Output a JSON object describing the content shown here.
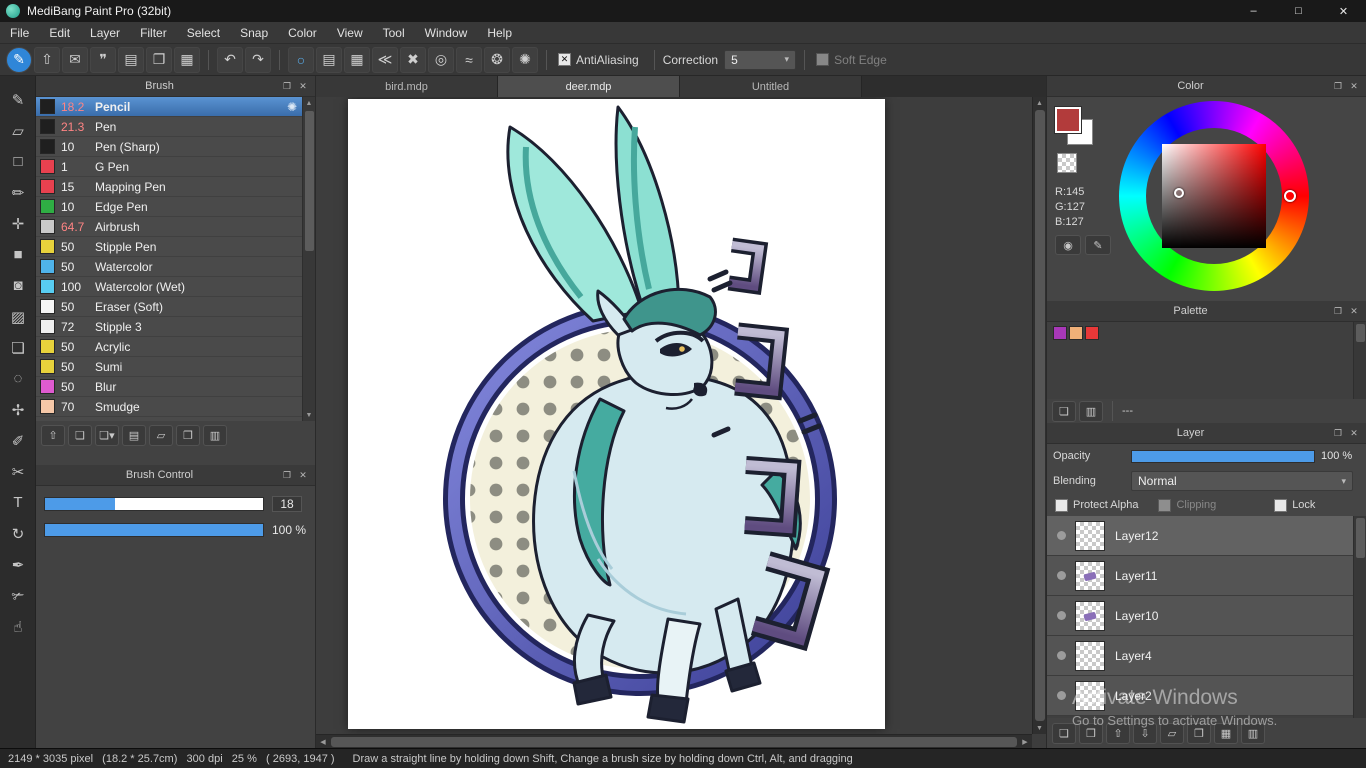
{
  "window": {
    "title": "MediBang Paint Pro (32bit)",
    "minimize": "–",
    "maximize": "□",
    "close": "✕"
  },
  "menu": {
    "items": [
      "File",
      "Edit",
      "Layer",
      "Filter",
      "Select",
      "Snap",
      "Color",
      "View",
      "Tool",
      "Window",
      "Help"
    ]
  },
  "ui": {
    "popout": "❐",
    "close": "✕",
    "up": "▲",
    "down": "▼",
    "left": "◀",
    "right": "▶",
    "caret": "▾",
    "check": "✕",
    "gear": "✺"
  },
  "toolbar": {
    "file_icons": [
      {
        "name": "pen-settings-icon",
        "glyph": "✎",
        "accent": true
      },
      {
        "name": "upload-icon",
        "glyph": "⇧"
      },
      {
        "name": "comment-icon",
        "glyph": "✉"
      },
      {
        "name": "chat-icon",
        "glyph": "❞"
      },
      {
        "name": "new-document-icon",
        "glyph": "▤"
      },
      {
        "name": "copy-document-icon",
        "glyph": "❐"
      },
      {
        "name": "panel-layout-icon",
        "glyph": "▦"
      }
    ],
    "undo_glyph": "↶",
    "redo_glyph": "↷",
    "snap_icons": [
      {
        "name": "snap-off-icon",
        "glyph": "○",
        "blue": true
      },
      {
        "name": "snap-parallel-icon",
        "glyph": "▤"
      },
      {
        "name": "snap-grid-icon",
        "glyph": "▦"
      },
      {
        "name": "snap-vanishing-icon",
        "glyph": "≪"
      },
      {
        "name": "snap-cross-icon",
        "glyph": "✖"
      },
      {
        "name": "snap-radial-icon",
        "glyph": "◎"
      },
      {
        "name": "snap-curve-icon",
        "glyph": "≈"
      },
      {
        "name": "snap-settings-icon",
        "glyph": "❂"
      },
      {
        "name": "settings-icon",
        "glyph": "✺"
      }
    ],
    "antialiasing_label": "AntiAliasing",
    "correction_label": "Correction",
    "correction_value": "5",
    "soft_edge_label": "Soft Edge"
  },
  "tool_strip": [
    {
      "name": "brush-tool",
      "glyph": "✎"
    },
    {
      "name": "eraser-tool",
      "glyph": "▱"
    },
    {
      "name": "figure-brush-tool",
      "glyph": "□"
    },
    {
      "name": "dot-tool",
      "glyph": "✏"
    },
    {
      "name": "move-tool",
      "glyph": "✛"
    },
    {
      "name": "fill-tool",
      "glyph": "■"
    },
    {
      "name": "bucket-tool",
      "glyph": "◙"
    },
    {
      "name": "gradient-tool",
      "glyph": "▨"
    },
    {
      "name": "select-tool",
      "glyph": "❏"
    },
    {
      "name": "lasso-tool",
      "glyph": "◌"
    },
    {
      "name": "magic-wand-tool",
      "glyph": "✢"
    },
    {
      "name": "select-pen-tool",
      "glyph": "✐"
    },
    {
      "name": "select-eraser-tool",
      "glyph": "✂"
    },
    {
      "name": "text-tool",
      "glyph": "T"
    },
    {
      "name": "operation-tool",
      "glyph": "↻"
    },
    {
      "name": "eyedropper-tool",
      "glyph": "✒"
    },
    {
      "name": "divide-tool",
      "glyph": "✃"
    },
    {
      "name": "hand-tool",
      "glyph": "☝"
    }
  ],
  "brush_panel": {
    "title": "Brush",
    "brushes": [
      {
        "size": "18.2",
        "name": "Pencil",
        "swatch": "#1f1f1f",
        "selected": true,
        "size_color": "#ff8484"
      },
      {
        "size": "21.3",
        "name": "Pen",
        "swatch": "#1f1f1f",
        "size_color": "#ff8484"
      },
      {
        "size": "10",
        "name": "Pen (Sharp)",
        "swatch": "#1f1f1f"
      },
      {
        "size": "1",
        "name": "G Pen",
        "swatch": "#e8414f"
      },
      {
        "size": "15",
        "name": "Mapping Pen",
        "swatch": "#e8414f"
      },
      {
        "size": "10",
        "name": "Edge Pen",
        "swatch": "#2fae44"
      },
      {
        "size": "64.7",
        "name": "Airbrush",
        "swatch": "#c9c9c9",
        "size_color": "#ff8484"
      },
      {
        "size": "50",
        "name": "Stipple Pen",
        "swatch": "#e8d23c"
      },
      {
        "size": "50",
        "name": "Watercolor",
        "swatch": "#4fb3ea"
      },
      {
        "size": "100",
        "name": "Watercolor (Wet)",
        "swatch": "#58cdf2"
      },
      {
        "size": "50",
        "name": "Eraser (Soft)",
        "swatch": "#f5f5f5"
      },
      {
        "size": "72",
        "name": "Stipple 3",
        "swatch": "#efefef"
      },
      {
        "size": "50",
        "name": "Acrylic",
        "swatch": "#e8d23c"
      },
      {
        "size": "50",
        "name": "Sumi",
        "swatch": "#e8d23c"
      },
      {
        "size": "50",
        "name": "Blur",
        "swatch": "#df5bd0"
      },
      {
        "size": "70",
        "name": "Smudge",
        "swatch": "#f6c8a8"
      }
    ],
    "footer_icons": [
      {
        "name": "cloud-brush-icon",
        "glyph": "⇧"
      },
      {
        "name": "add-brush-icon",
        "glyph": "❏"
      },
      {
        "name": "add-brush-menu-icon",
        "glyph": "❏▾"
      },
      {
        "name": "brush-script-icon",
        "glyph": "▤"
      },
      {
        "name": "brush-folder-icon",
        "glyph": "▱"
      },
      {
        "name": "duplicate-brush-icon",
        "glyph": "❐"
      },
      {
        "name": "delete-brush-icon",
        "glyph": "▥"
      }
    ]
  },
  "brush_control": {
    "title": "Brush Control",
    "size_value": "18",
    "size_fill_pct": 32,
    "opacity_value": "100 %",
    "opacity_fill_pct": 100
  },
  "tabs": [
    {
      "label": "bird.mdp"
    },
    {
      "label": "deer.mdp",
      "active": true
    },
    {
      "label": "Untitled"
    }
  ],
  "color_panel": {
    "title": "Color",
    "foreground_color": "#b23b3b",
    "background_color": "#ffffff",
    "rgb_lines": [
      "R:145",
      "G:127",
      "B:127"
    ],
    "buttons": [
      {
        "name": "color-wheel-button",
        "glyph": "◉"
      },
      {
        "name": "color-palette-button",
        "glyph": "✎"
      }
    ]
  },
  "palette_panel": {
    "title": "Palette",
    "swatches": [
      "#a838b8",
      "#f0b078",
      "#e83838"
    ],
    "empty_value": "---",
    "footer_icons": [
      {
        "name": "add-color-icon",
        "glyph": "❏"
      },
      {
        "name": "delete-color-icon",
        "glyph": "▥"
      }
    ]
  },
  "layer_panel": {
    "title": "Layer",
    "opacity_label": "Opacity",
    "opacity_value": "100 %",
    "opacity_fill_pct": 100,
    "blending_label": "Blending",
    "blending_value": "Normal",
    "protect_alpha_label": "Protect Alpha",
    "clipping_label": "Clipping",
    "lock_label": "Lock",
    "layers": [
      {
        "name": "Layer12",
        "selected": true
      },
      {
        "name": "Layer11",
        "mark": "#8a6fb8"
      },
      {
        "name": "Layer10",
        "mark": "#8a6fb8"
      },
      {
        "name": "Layer4"
      },
      {
        "name": "Layer2"
      }
    ],
    "footer_icons": [
      {
        "name": "add-layer-icon",
        "glyph": "❏"
      },
      {
        "name": "add-layer-menu-icon",
        "glyph": "❒"
      },
      {
        "name": "move-layer-up-icon",
        "glyph": "⇧"
      },
      {
        "name": "move-layer-down-icon",
        "glyph": "⇩"
      },
      {
        "name": "layer-folder-icon",
        "glyph": "▱"
      },
      {
        "name": "duplicate-layer-icon",
        "glyph": "❐"
      },
      {
        "name": "merge-layer-icon",
        "glyph": "▦"
      },
      {
        "name": "delete-layer-icon",
        "glyph": "▥"
      }
    ]
  },
  "status_bar": {
    "info": "2149 * 3035 pixel   (18.2 * 25.7cm)   300 dpi   25 %   ( 2693, 1947 )",
    "hint": "Draw a straight line by holding down Shift, Change a brush size by holding down Ctrl, Alt, and dragging"
  },
  "watermark": {
    "line1": "Activate Windows",
    "line2": "Go to Settings to activate Windows."
  },
  "accent_colors": {
    "selection_blue": "#3f7cc0",
    "slider_blue": "#4d9be8"
  }
}
